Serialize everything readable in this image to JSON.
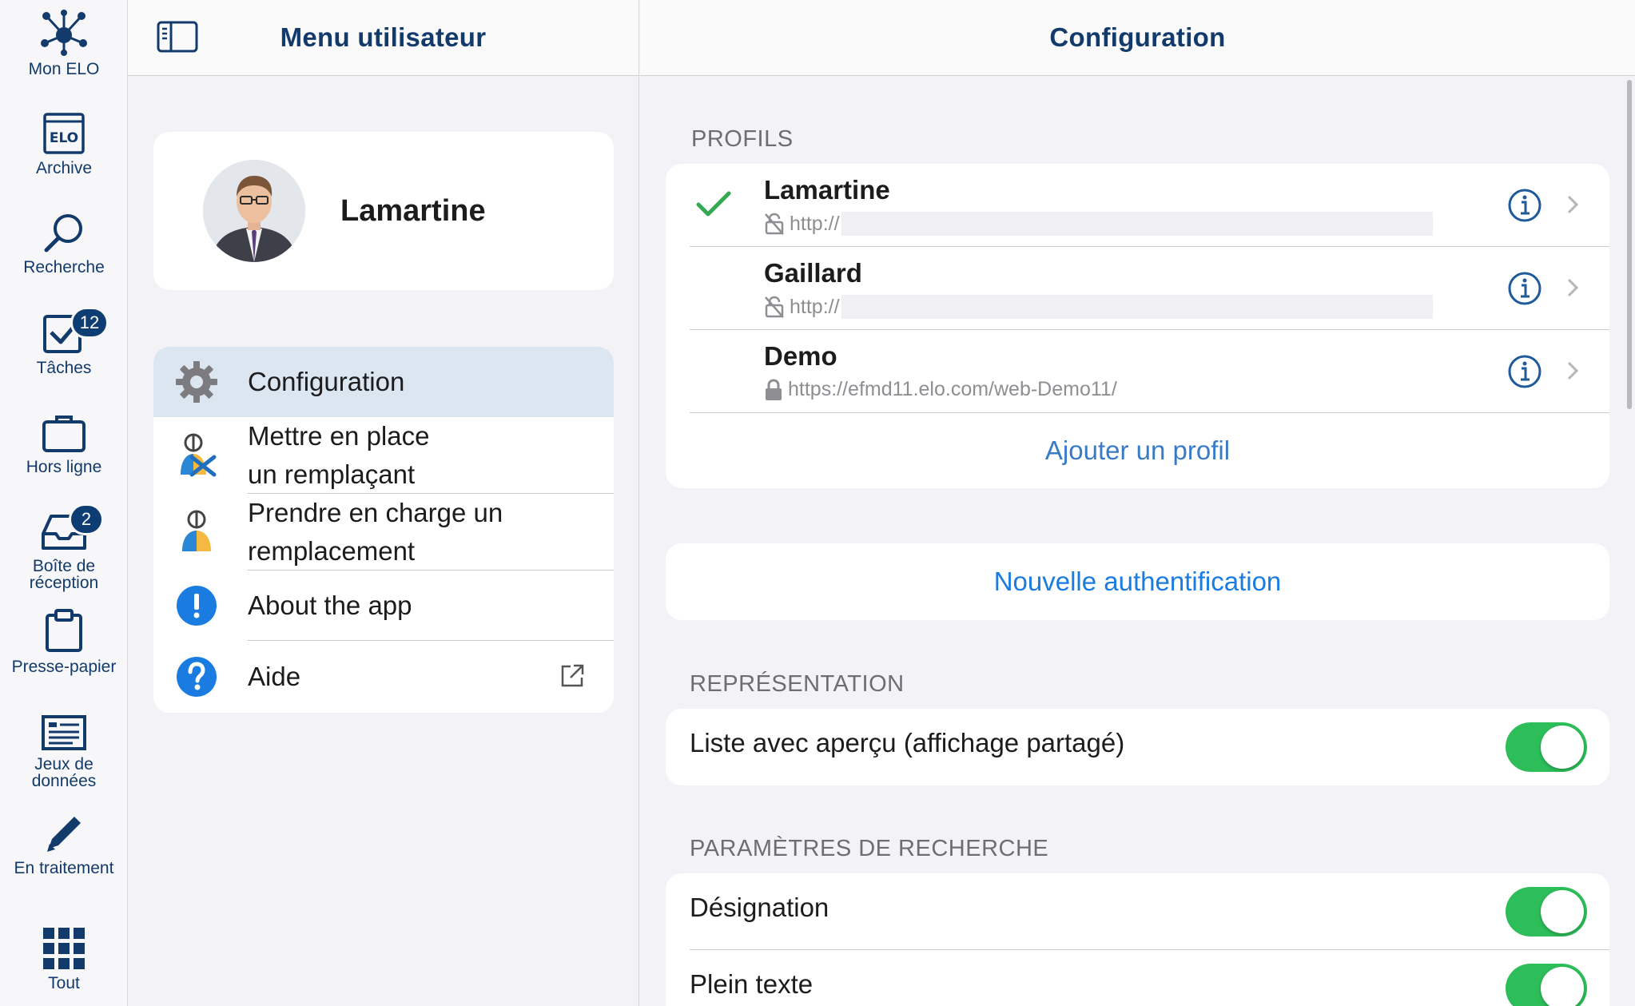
{
  "rail": {
    "items": [
      {
        "label": "Mon ELO",
        "icon": "network-hub-icon"
      },
      {
        "label": "Archive",
        "icon": "elo-archive-icon"
      },
      {
        "label": "Recherche",
        "icon": "search-icon"
      },
      {
        "label": "Tâches",
        "icon": "tasks-checkbox-icon",
        "badge": "12"
      },
      {
        "label": "Hors ligne",
        "icon": "briefcase-icon"
      },
      {
        "label": "Boîte de\nréception",
        "icon": "inbox-tray-icon",
        "badge": "2"
      },
      {
        "label": "Presse-papier",
        "icon": "clipboard-icon"
      },
      {
        "label": "Jeux de\ndonnées",
        "icon": "form-list-icon"
      },
      {
        "label": "En traitement",
        "icon": "pencil-icon"
      },
      {
        "label": "Tout",
        "icon": "grid-apps-icon"
      }
    ]
  },
  "middle": {
    "title": "Menu utilisateur",
    "profile_name": "Lamartine",
    "menu": [
      {
        "label": "Configuration",
        "icon": "gear-icon",
        "selected": true
      },
      {
        "label": "Mettre en place\nun remplaçant",
        "icon": "set-substitute-icon"
      },
      {
        "label": "Prendre en charge un\nremplacement",
        "icon": "take-over-substitution-icon"
      },
      {
        "label": "About the app",
        "icon": "exclamation-circle-icon"
      },
      {
        "label": "Aide",
        "icon": "question-circle-icon",
        "trailing_icon": "external-link-icon"
      }
    ]
  },
  "right": {
    "title": "Configuration",
    "profiles_header": "PROFILS",
    "profiles": [
      {
        "name": "Lamartine",
        "url": "http://",
        "secure": false,
        "active": true
      },
      {
        "name": "Gaillard",
        "url": "http://",
        "secure": false,
        "active": false
      },
      {
        "name": "Demo",
        "url": "https://efmd11.elo.com/web-Demo11/",
        "secure": true,
        "active": false
      }
    ],
    "add_profile": "Ajouter un profil",
    "reauth": "Nouvelle authentification",
    "representation_header": "REPRÉSENTATION",
    "representation_toggle": {
      "label": "Liste avec aperçu (affichage partagé)",
      "on": true
    },
    "search_header": "PARAMÈTRES DE RECHERCHE",
    "search_toggles": [
      {
        "label": "Désignation",
        "on": true
      },
      {
        "label": "Plein texte",
        "on": true
      }
    ]
  },
  "colors": {
    "navy": "#123a6b",
    "link_blue": "#1a7ce0",
    "toggle_green": "#2dbe5a",
    "check_green": "#34a853",
    "selected_bg": "#dce6f1"
  }
}
